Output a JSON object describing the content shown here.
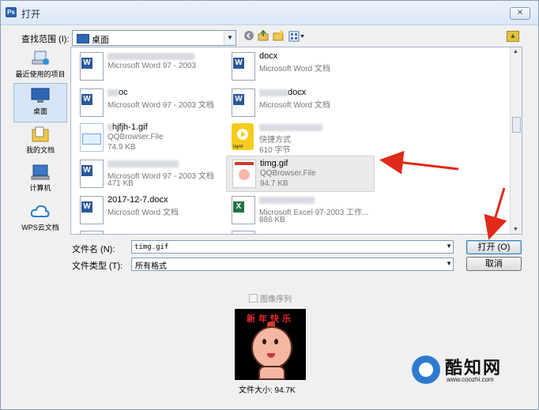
{
  "window": {
    "title": "打开",
    "app_icon": "Ps",
    "close_glyph": "✕"
  },
  "toolbar": {
    "look_in_label": "查找范围 (I):",
    "look_in_value": "桌面",
    "icons": [
      "back-icon",
      "up-folder-icon",
      "new-folder-icon",
      "view-menu-icon"
    ]
  },
  "places": [
    {
      "label": "最近使用的项目",
      "icon": "recent-items-icon"
    },
    {
      "label": "桌面",
      "icon": "desktop-icon",
      "active": true
    },
    {
      "label": "我的文档",
      "icon": "my-documents-icon"
    },
    {
      "label": "计算机",
      "icon": "computer-icon"
    },
    {
      "label": "WPS云文档",
      "icon": "cloud-icon"
    }
  ],
  "files": [
    {
      "name": "",
      "type": "Microsoft Word 97 - 2003",
      "size": "",
      "icon": "word-doc-icon"
    },
    {
      "name": "docx",
      "type": "Microsoft Word 文档",
      "size": "",
      "icon": "word-doc-icon"
    },
    {
      "name": "oc",
      "type": "Microsoft Word 97 - 2003 文档",
      "size": "",
      "icon": "word-doc-icon"
    },
    {
      "name": "docx",
      "type": "Microsoft Word 文档",
      "size": "",
      "icon": "word-doc-icon"
    },
    {
      "name": "hjfjh-1.gif",
      "type": "QQBrowser.File",
      "size": "74.9 KB",
      "icon": "gif-thumbnail-icon"
    },
    {
      "name": "",
      "type": "快捷方式",
      "size": "610 字节",
      "icon": "layer-shortcut-icon",
      "badge": "layer"
    },
    {
      "name": "",
      "type": "Microsoft Word 97 - 2003 文档",
      "size": "471 KB",
      "icon": "word-doc-icon"
    },
    {
      "name": "timg.gif",
      "type": "QQBrowser.File",
      "size": "94.7 KB",
      "icon": "gif-thumbnail-icon",
      "selected": true
    },
    {
      "name": "2017-12-7.docx",
      "type": "Microsoft Word 文档",
      "size": "",
      "icon": "word-doc-icon"
    },
    {
      "name": "",
      "type": "Microsoft Excel 97-2003 工作...",
      "size": "886 KB",
      "icon": "excel-doc-icon"
    }
  ],
  "filename": {
    "label": "文件名 (N):",
    "value": "timg.gif"
  },
  "filetype": {
    "label": "文件类型 (T):",
    "value": "所有格式"
  },
  "buttons": {
    "open": "打开 (O)",
    "cancel": "取消"
  },
  "image_sequence": {
    "label": "图像序列",
    "checked": false
  },
  "preview": {
    "caption_text": "新年快乐",
    "file_size": "文件大小: 94.7K"
  },
  "watermark": {
    "title": "酷知网",
    "url": "www.coozhi.com"
  }
}
